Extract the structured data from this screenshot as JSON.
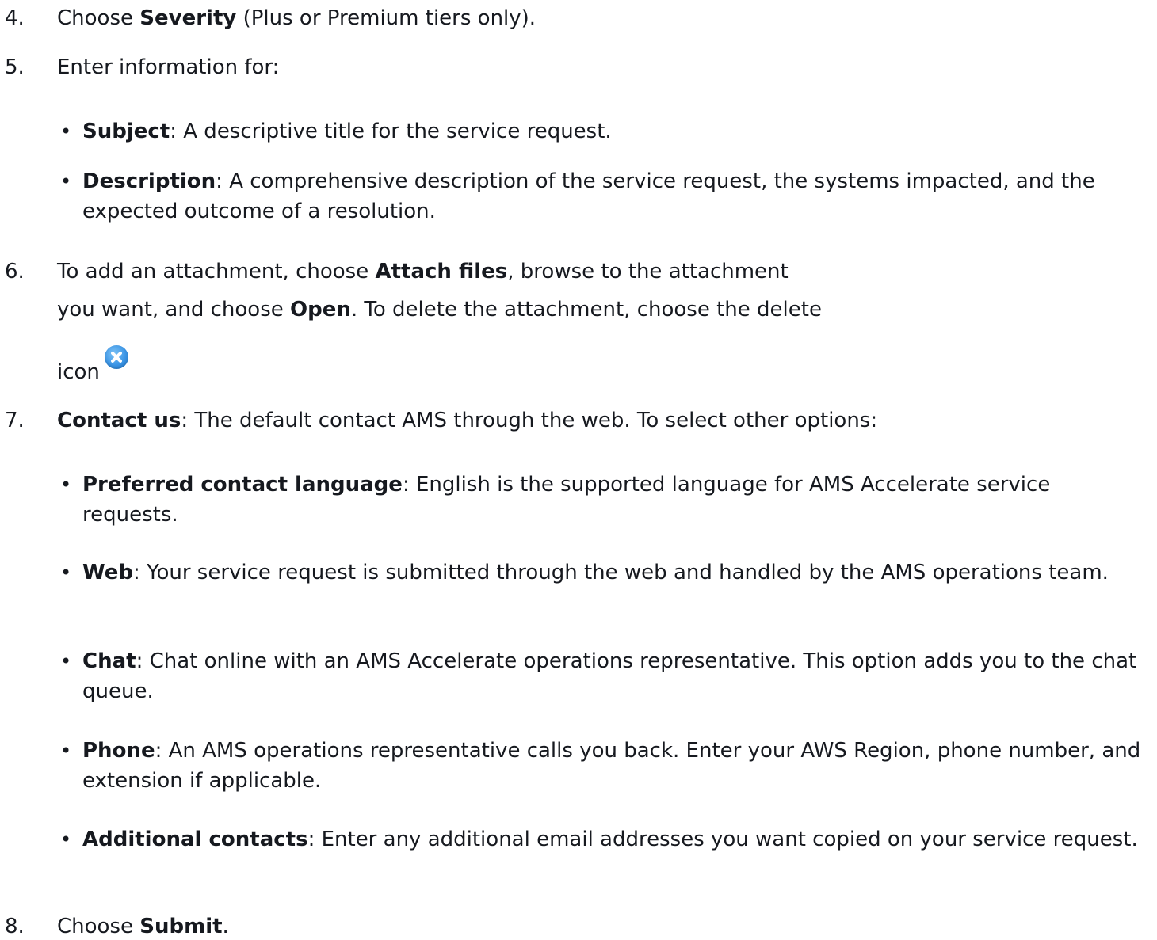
{
  "steps": {
    "s4": {
      "num": "4.",
      "pre": "Choose ",
      "bold": "Severity",
      "post": " (Plus or Premium tiers only)."
    },
    "s5": {
      "num": "5.",
      "text": "Enter information for:",
      "bullets": [
        {
          "bold": "Subject",
          "text": ": A descriptive title for the service request."
        },
        {
          "bold": "Description",
          "text": ": A comprehensive description of the service request, the systems impacted, and the expected outcome of a resolution."
        }
      ]
    },
    "s6": {
      "num": "6.",
      "pre": "To add an attachment, choose ",
      "bold1": "Attach files",
      "mid1": ", browse to the attachment",
      "line2_pre": "you want, and choose ",
      "bold2": "Open",
      "mid2": ". To delete the attachment, choose the delete",
      "line3": "icon",
      "icon": "delete-circle-x-icon",
      "icon_color": "#3b95e6"
    },
    "s7": {
      "num": "7.",
      "bold": "Contact us",
      "text": ": The default contact AMS through the web. To select other options:",
      "bullets": [
        {
          "bold": "Preferred contact language",
          "text": ": English is the supported language for AMS Accelerate service requests."
        },
        {
          "bold": "Web",
          "text": ": Your service request is submitted through the web and handled by the AMS operations team."
        },
        {
          "bold": "Chat",
          "text": ": Chat online with an AMS Accelerate operations representative. This option adds you to the chat queue."
        },
        {
          "bold": "Phone",
          "text": ": An AMS operations representative calls you back. Enter your AWS Region, phone number, and extension if applicable."
        },
        {
          "bold": "Additional contacts",
          "text": ": Enter any additional email addresses you want copied on your service request."
        }
      ]
    },
    "s8": {
      "num": "8.",
      "pre": "Choose ",
      "bold": "Submit",
      "post": "."
    }
  }
}
